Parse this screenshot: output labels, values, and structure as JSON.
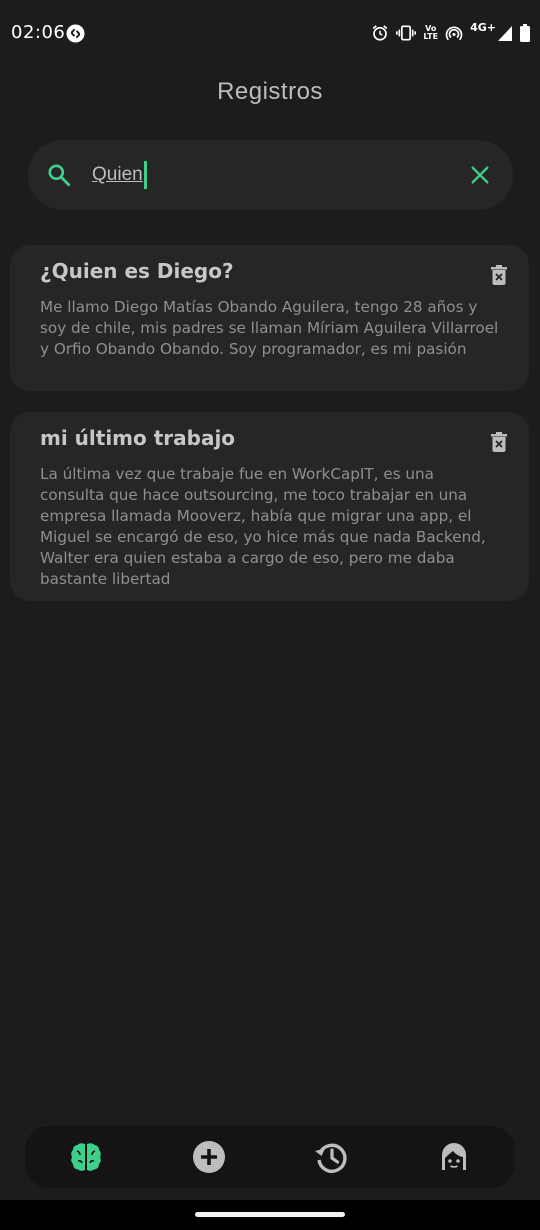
{
  "status_bar": {
    "time": "02:06",
    "network": "4G+",
    "volte_top": "Vo",
    "volte_bottom": "LTE"
  },
  "header": {
    "title": "Registros"
  },
  "search": {
    "value": "Quien",
    "placeholder": ""
  },
  "records": [
    {
      "title": "¿Quien es Diego?",
      "body": "Me llamo Diego Matías Obando Aguilera, tengo 28 años y soy de chile, mis padres se llaman Míriam Aguilera Villarroel y Orfio Obando Obando. Soy programador, es mi pasión"
    },
    {
      "title": "mi último trabajo",
      "body": "La última vez que trabaje fue en WorkCapIT, es una consulta que hace outsourcing, me toco trabajar en una empresa llamada Mooverz, había que migrar una app, el Miguel se encargó de eso, yo hice más que nada Backend, Walter era quien estaba a cargo de eso, pero me daba bastante libertad"
    }
  ],
  "bottom_nav": {
    "items": [
      {
        "icon": "brain-icon",
        "active": true
      },
      {
        "icon": "add-circle-icon",
        "active": false
      },
      {
        "icon": "history-icon",
        "active": false
      },
      {
        "icon": "face-icon",
        "active": false
      }
    ]
  },
  "colors": {
    "background": "#1c1c1c",
    "card": "#262626",
    "accent": "#3ed08a",
    "icon": "#bdbdbd",
    "text_primary": "#c7c7c7",
    "text_secondary": "#8f8f8f"
  }
}
